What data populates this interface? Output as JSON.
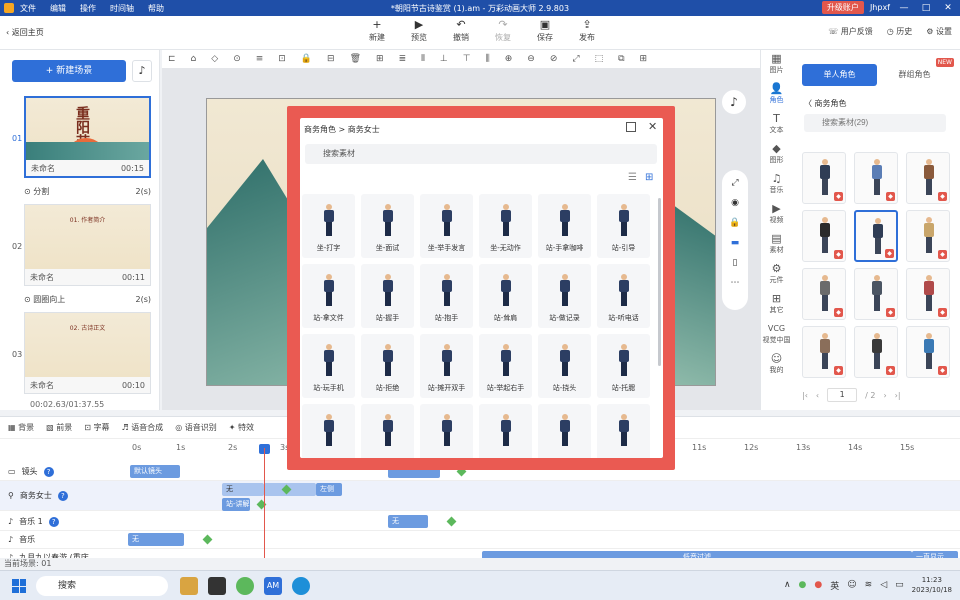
{
  "titlebar": {
    "menu": [
      "文件",
      "编辑",
      "操作",
      "时间轴",
      "帮助"
    ],
    "title": "*朝阳节古诗鉴赏 (1).am - 万彩动画大师 2.9.803",
    "upgrade": "升级账户",
    "user": "Jhpxf",
    "min": "—",
    "max": "□",
    "close": "✕"
  },
  "toolbar": {
    "back": "返回主页",
    "tools": [
      {
        "icon": "+",
        "label": "新建",
        "disabled": false
      },
      {
        "icon": "▶",
        "label": "预览",
        "disabled": false
      },
      {
        "icon": "↶",
        "label": "撤销",
        "disabled": false
      },
      {
        "icon": "↷",
        "label": "恢复",
        "disabled": true
      },
      {
        "icon": "▣",
        "label": "保存",
        "disabled": false
      },
      {
        "icon": "⇪",
        "label": "发布",
        "disabled": false
      }
    ],
    "right": [
      "用户反馈",
      "历史",
      "设置"
    ]
  },
  "left": {
    "new_scene": "新建场景",
    "scenes": [
      {
        "num": "01",
        "name": "未命名",
        "time": "00:15",
        "thumb_text": "重阳节",
        "transition": "分割",
        "trans_time": "2(s)"
      },
      {
        "num": "02",
        "name": "未命名",
        "time": "00:11",
        "thumb_text": "01. 作者简介",
        "transition": "圆圈向上",
        "trans_time": "2(s)"
      },
      {
        "num": "03",
        "name": "未命名",
        "time": "00:10",
        "thumb_text": "02. 古诗正文"
      }
    ],
    "total_time": "00:02.63/01:37.55"
  },
  "canvas_tools": [
    "⊏",
    "⌂",
    "◇",
    "⊙",
    "≡",
    "⊡",
    "🔒",
    "⊟",
    "🗑",
    "⊞",
    "≣",
    "⫴",
    "⊥",
    "⊤",
    "⫼",
    "⊕",
    "⊖",
    "⊘",
    "⤢",
    "⬚",
    "⧉",
    "⊞"
  ],
  "iconcol": [
    {
      "glyph": "▦",
      "label": "图片",
      "active": false
    },
    {
      "glyph": "👤",
      "label": "角色",
      "active": true
    },
    {
      "glyph": "T",
      "label": "文本",
      "active": false
    },
    {
      "glyph": "◆",
      "label": "图形",
      "active": false
    },
    {
      "glyph": "♫",
      "label": "音乐",
      "active": false
    },
    {
      "glyph": "▶",
      "label": "视频",
      "active": false
    },
    {
      "glyph": "▤",
      "label": "素材",
      "active": false
    },
    {
      "glyph": "⚙",
      "label": "元件",
      "active": false
    },
    {
      "glyph": "⊞",
      "label": "其它",
      "active": false
    },
    {
      "glyph": "VCG",
      "label": "视觉中国",
      "active": false
    },
    {
      "glyph": "☺",
      "label": "我的",
      "active": false
    }
  ],
  "rpanel": {
    "tab_single": "单人角色",
    "tab_multi": "群组角色",
    "new_badge": "NEW",
    "crumb": "〈 商务角色",
    "search": "搜索素材(29)",
    "page": "1",
    "total_pages": "/ 2"
  },
  "timeline": {
    "tools": [
      "背景",
      "前景",
      "字幕",
      "语音合成",
      "语音识别",
      "特效"
    ],
    "ruler": [
      "0s",
      "1s",
      "2s",
      "3s",
      "11s",
      "12s",
      "13s",
      "14s",
      "15s"
    ],
    "rows": [
      {
        "label": "镜头",
        "help": "?"
      },
      {
        "label": "商务女士",
        "help": "?"
      },
      {
        "label": "音乐 1",
        "help": "?"
      },
      {
        "label": "音乐",
        "help": ""
      },
      {
        "label": "九月九以春游 (重庆...",
        "help": ""
      }
    ],
    "clips": {
      "camera": "默认镜头",
      "none1": "无",
      "left": "左侧",
      "stand": "站-讲解",
      "none2": "无",
      "none3": "无",
      "none4": "无",
      "none5": "无",
      "lowpass": "低音过滤",
      "fadeout": "一直显示"
    },
    "status": "当前场景: 01"
  },
  "taskbar": {
    "search": "搜索",
    "app_am": "AM",
    "lang": "英",
    "time": "11:23",
    "date": "2023/10/18"
  },
  "modal": {
    "crumb": "商务角色 > 商务女士",
    "search": "搜索素材",
    "poses": [
      "坐-打字",
      "坐-面试",
      "坐-举手发言",
      "坐-无动作",
      "站-手拿咖啡",
      "站-引导",
      "站-拿文件",
      "站-握手",
      "站-抱手",
      "站-耸肩",
      "站-做记录",
      "站-听电话",
      "站-玩手机",
      "站-拒绝",
      "站-摊开双手",
      "站-举起右手",
      "站-挠头",
      "站-托腮",
      "",
      "",
      "",
      "",
      "",
      ""
    ]
  }
}
